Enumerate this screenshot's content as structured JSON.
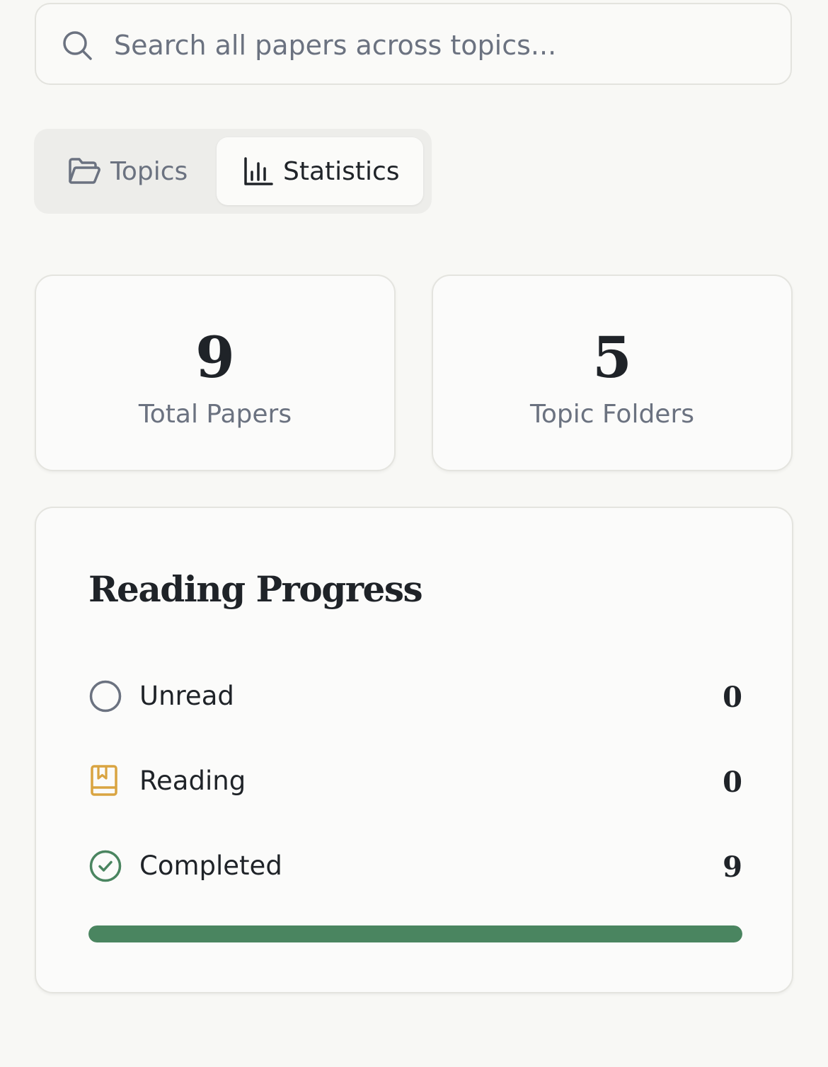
{
  "search": {
    "placeholder": "Search all papers across topics...",
    "icon": "search-icon"
  },
  "tabs": [
    {
      "label": "Topics",
      "icon": "folder-open-icon",
      "active": false
    },
    {
      "label": "Statistics",
      "icon": "bar-chart-icon",
      "active": true
    }
  ],
  "stats": {
    "total_papers": {
      "value": "9",
      "label": "Total Papers"
    },
    "topic_folders": {
      "value": "5",
      "label": "Topic Folders"
    }
  },
  "progress": {
    "title": "Reading Progress",
    "rows": [
      {
        "label": "Unread",
        "count": "0",
        "icon": "empty-circle-icon",
        "color": "#6b7280"
      },
      {
        "label": "Reading",
        "count": "0",
        "icon": "book-bookmark-icon",
        "color": "#d9a441"
      },
      {
        "label": "Completed",
        "count": "9",
        "icon": "check-circle-icon",
        "color": "#4a8560"
      }
    ],
    "completed_fraction": 1.0,
    "bar_color": "#4a8560"
  }
}
